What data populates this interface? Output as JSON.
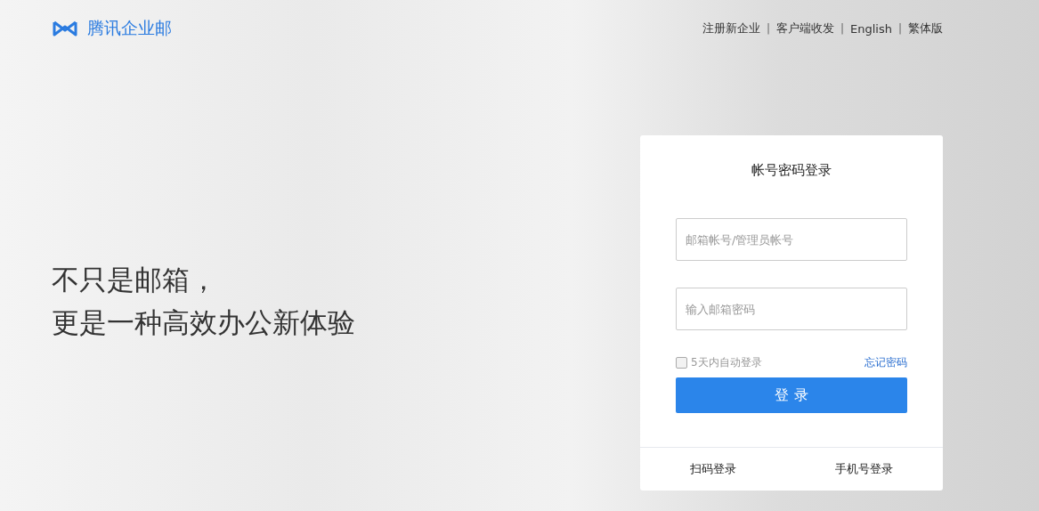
{
  "header": {
    "brand": "腾讯企业邮",
    "links": [
      {
        "label": "注册新企业"
      },
      {
        "label": "客户端收发"
      },
      {
        "label": "English"
      },
      {
        "label": "繁体版"
      }
    ],
    "separators": [
      "|",
      "|",
      "|"
    ]
  },
  "slogan": [
    "不只是邮箱，",
    "更是一种高效办公新体验"
  ],
  "login": {
    "title": "帐号密码登录",
    "account": {
      "placeholder": "邮箱帐号/管理员帐号"
    },
    "password": {
      "placeholder": "输入邮箱密码"
    },
    "remember": {
      "label": "5天内自动登录",
      "checked": false
    },
    "forgot": "忘记密码",
    "submit": "登 录",
    "alternatives": [
      "扫码登录",
      "手机号登录"
    ]
  }
}
